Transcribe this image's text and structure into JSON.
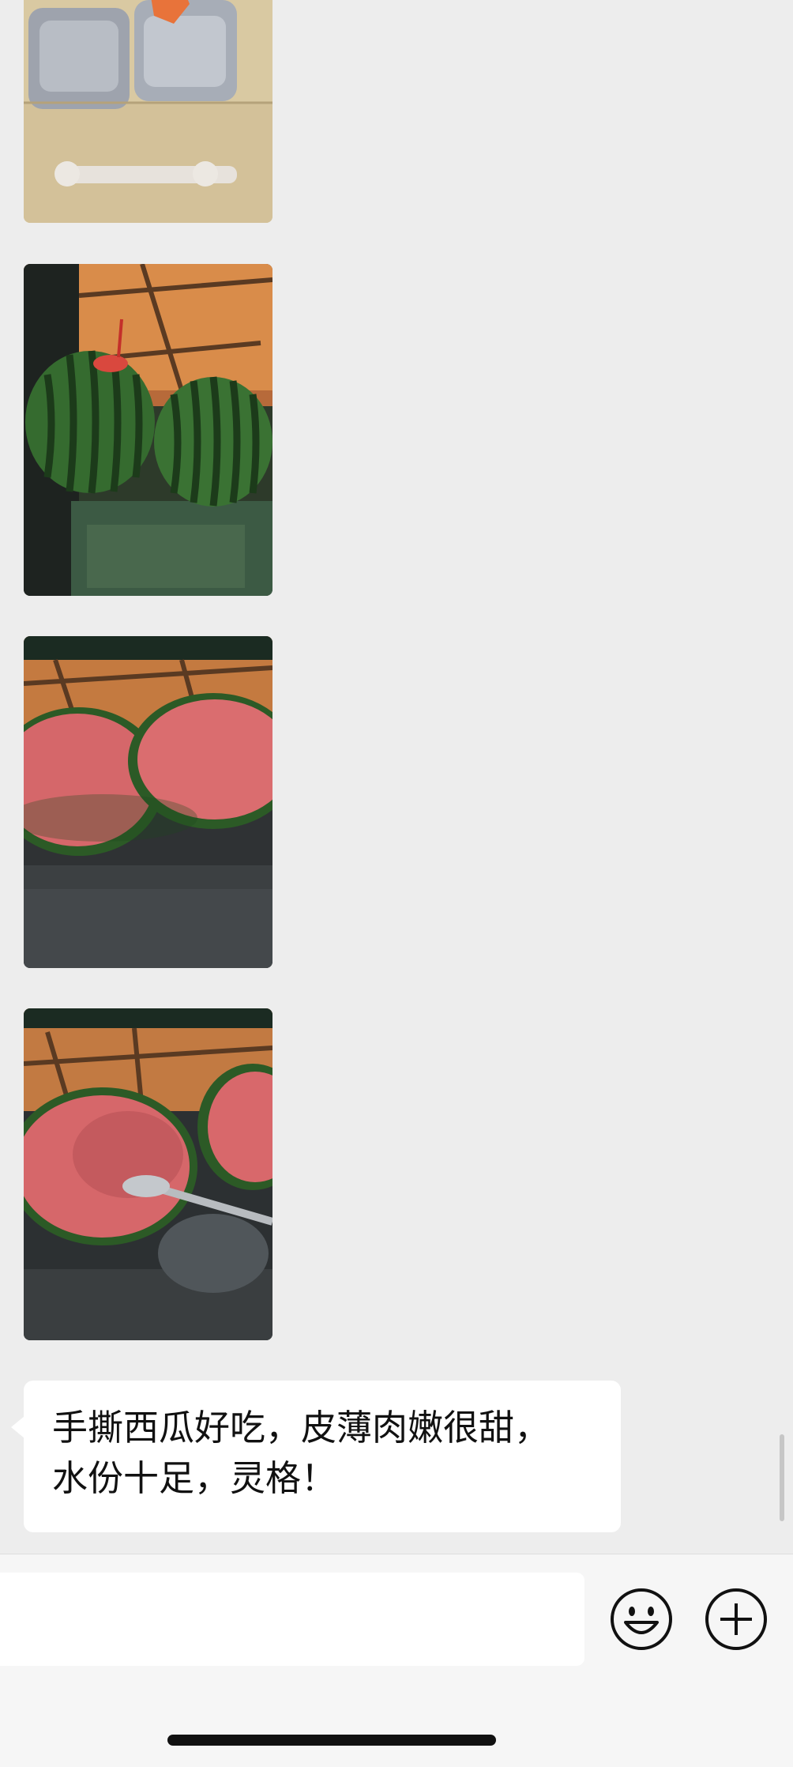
{
  "chat": {
    "images": [
      {
        "description_icon": "photo-icon"
      },
      {
        "description_icon": "photo-icon"
      },
      {
        "description_icon": "photo-icon"
      },
      {
        "description_icon": "photo-icon"
      }
    ],
    "message": {
      "line1": "手撕西瓜好吃，皮薄肉嫩很甜，",
      "line2": "水份十足，灵格！"
    }
  },
  "input_bar": {
    "placeholder": "",
    "emoji_icon": "emoji-smile-icon",
    "more_icon": "plus-circle-icon"
  },
  "colors": {
    "background": "#ededed",
    "bubble": "#ffffff",
    "input_bar": "#f6f6f6"
  }
}
